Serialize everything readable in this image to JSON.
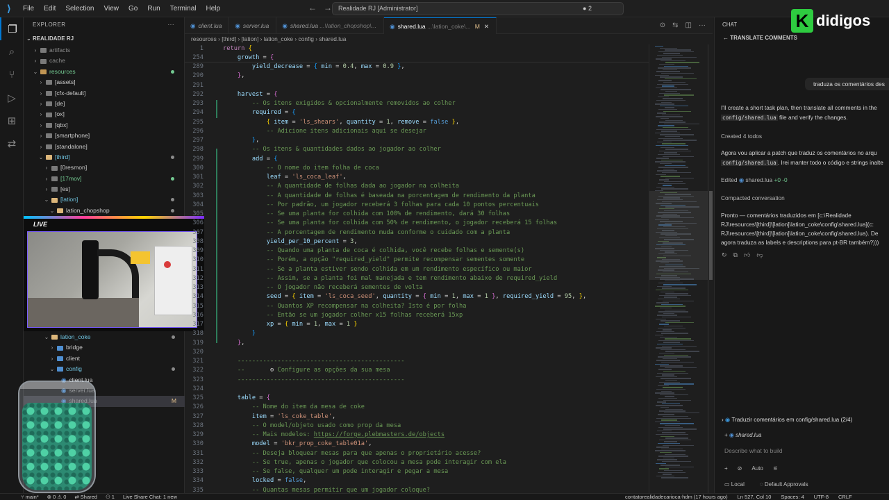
{
  "title_bar": {
    "menu": [
      "File",
      "Edit",
      "Selection",
      "View",
      "Go",
      "Run",
      "Terminal",
      "Help"
    ],
    "search_text": "Realidade RJ [Administrator]",
    "badge": "2"
  },
  "explorer": {
    "header": "EXPLORER",
    "root": "REALIDADE RJ",
    "items": [
      {
        "label": "artifacts",
        "indent": 1,
        "chev": "›"
      },
      {
        "label": "cache",
        "indent": 1,
        "chev": "›"
      },
      {
        "label": "resources",
        "indent": 1,
        "chev": "⌄"
      },
      {
        "label": "[assets]",
        "indent": 2,
        "chev": "›"
      },
      {
        "label": "[cfx-default]",
        "indent": 2,
        "chev": "›"
      },
      {
        "label": "[de]",
        "indent": 2,
        "chev": "›"
      },
      {
        "label": "[ox]",
        "indent": 2,
        "chev": "›"
      },
      {
        "label": "[qbx]",
        "indent": 2,
        "chev": "›"
      },
      {
        "label": "[smartphone]",
        "indent": 2,
        "chev": "›"
      },
      {
        "label": "[standalone]",
        "indent": 2,
        "chev": "›"
      },
      {
        "label": "[third]",
        "indent": 2,
        "chev": "⌄"
      },
      {
        "label": "[0resmon]",
        "indent": 3,
        "chev": "›"
      },
      {
        "label": "[17mov]",
        "indent": 3,
        "chev": "›"
      },
      {
        "label": "[es]",
        "indent": 3,
        "chev": "›"
      },
      {
        "label": "[lation]",
        "indent": 3,
        "chev": "⌄"
      },
      {
        "label": "lation_chopshop",
        "indent": 4,
        "chev": "⌄"
      }
    ],
    "items_lower": [
      {
        "label": "lation_coke",
        "indent": 3,
        "chev": "⌄"
      },
      {
        "label": "bridge",
        "indent": 4,
        "chev": "›"
      },
      {
        "label": "client",
        "indent": 4,
        "chev": "›"
      },
      {
        "label": "config",
        "indent": 4,
        "chev": "⌄"
      },
      {
        "label": "client.lua",
        "indent": 5,
        "chev": ""
      },
      {
        "label": "server.lua",
        "indent": 5,
        "chev": ""
      },
      {
        "label": "shared.lua",
        "indent": 5,
        "chev": ""
      }
    ],
    "modified_marker": "M",
    "live_label": "LIVE"
  },
  "tabs": [
    {
      "label": "client.lua",
      "sub": "",
      "active": false
    },
    {
      "label": "server.lua",
      "sub": "",
      "active": false
    },
    {
      "label": "shared.lua",
      "sub": "...\\lation_chopshop\\...",
      "active": false
    },
    {
      "label": "shared.lua",
      "sub": "...\\lation_coke\\...",
      "active": true,
      "mod": "M"
    }
  ],
  "breadcrumb": "resources › [third] › [lation] › lation_coke › config › shared.lua",
  "code": {
    "sticky": [
      {
        "n": "1",
        "t": "<span class='k'>return</span> <span class='br1'>{</span>"
      },
      {
        "n": "254",
        "t": "    <span class='v'>growth</span> = <span class='br2'>{</span>"
      }
    ],
    "lines": [
      {
        "n": "289",
        "t": "        <span class='v'>yield_decrease</span> = <span class='br3'>{</span> <span class='v'>min</span> = <span class='n'>0.4</span>, <span class='v'>max</span> = <span class='n'>0.9</span> <span class='br3'>}</span>,"
      },
      {
        "n": "290",
        "t": "    <span class='br2'>}</span>,"
      },
      {
        "n": "291",
        "t": ""
      },
      {
        "n": "292",
        "t": "    <span class='v'>harvest</span> = <span class='br2'>{</span>"
      },
      {
        "n": "293",
        "t": "        <span class='cm'>-- Os itens exigidos &amp; opcionalmente removidos ao colher</span>"
      },
      {
        "n": "294",
        "t": "        <span class='v'>required</span> = <span class='br3'>{</span>"
      },
      {
        "n": "295",
        "t": "            <span class='br1'>{</span> <span class='v'>item</span> = <span class='s'>'ls_shears'</span>, <span class='v'>quantity</span> = <span class='n'>1</span>, <span class='v'>remove</span> = <span class='kw2'>false</span> <span class='br1'>}</span>,"
      },
      {
        "n": "296",
        "t": "            <span class='cm'>-- Adicione itens adicionais aqui se desejar</span>"
      },
      {
        "n": "297",
        "t": "        <span class='br3'>}</span>,"
      },
      {
        "n": "298",
        "t": "        <span class='cm'>-- Os itens &amp; quantidades dados ao jogador ao colher</span>"
      },
      {
        "n": "299",
        "t": "        <span class='v'>add</span> = <span class='br3'>{</span>"
      },
      {
        "n": "300",
        "t": "            <span class='cm'>-- O nome do item folha de coca</span>"
      },
      {
        "n": "301",
        "t": "            <span class='v'>leaf</span> = <span class='s'>'ls_coca_leaf'</span>,"
      },
      {
        "n": "302",
        "t": "            <span class='cm'>-- A quantidade de folhas dada ao jogador na colheita</span>"
      },
      {
        "n": "303",
        "t": "            <span class='cm'>-- A quantidade de folhas é baseada na porcentagem de rendimento da planta</span>"
      },
      {
        "n": "304",
        "t": "            <span class='cm'>-- Por padrão, um jogador receberá 3 folhas para cada 10 pontos percentuais</span>"
      },
      {
        "n": "305",
        "t": "            <span class='cm'>-- Se uma planta for colhida com 100% de rendimento, dará 30 folhas</span>"
      },
      {
        "n": "306",
        "t": "            <span class='cm'>-- Se uma planta for colhida com 50% de rendimento, o jogador receberá 15 folhas</span>"
      },
      {
        "n": "307",
        "t": "            <span class='cm'>-- A porcentagem de rendimento muda conforme o cuidado com a planta</span>"
      },
      {
        "n": "308",
        "t": "            <span class='v'>yield_per_10_percent</span> = <span class='n'>3</span>,"
      },
      {
        "n": "309",
        "t": "            <span class='cm'>-- Quando uma planta de coca é colhida, você recebe folhas e semente(s)</span>"
      },
      {
        "n": "310",
        "t": "            <span class='cm'>-- Porém, a opção \"required_yield\" permite recompensar sementes somente</span>"
      },
      {
        "n": "311",
        "t": "            <span class='cm'>-- Se a planta estiver sendo colhida em um rendimento específico ou maior</span>"
      },
      {
        "n": "312",
        "t": "            <span class='cm'>-- Assim, se a planta foi mal manejada e tem rendimento abaixo de required_yield</span>"
      },
      {
        "n": "313",
        "t": "            <span class='cm'>-- O jogador não receberá sementes de volta</span>"
      },
      {
        "n": "314",
        "t": "            <span class='v'>seed</span> = <span class='br1'>{</span> <span class='v'>item</span> = <span class='s'>'ls_coca_seed'</span>, <span class='v'>quantity</span> = <span class='br2'>{</span> <span class='v'>min</span> = <span class='n'>1</span>, <span class='v'>max</span> = <span class='n'>1</span> <span class='br2'>}</span>, <span class='v'>required_yield</span> = <span class='n'>95</span>, <span class='br1'>}</span>,"
      },
      {
        "n": "315",
        "t": "            <span class='cm'>-- Quantos XP recompensar na colheita? Isto é por folha</span>"
      },
      {
        "n": "316",
        "t": "            <span class='cm'>-- Então se um jogador colher x15 folhas receberá 15xp</span>"
      },
      {
        "n": "317",
        "t": "            <span class='v'>xp</span> = <span class='br1'>{</span> <span class='v'>min</span> = <span class='n'>1</span>, <span class='v'>max</span> = <span class='n'>1</span> <span class='br1'>}</span>"
      },
      {
        "n": "318",
        "t": "        <span class='br3'>}</span>"
      },
      {
        "n": "319",
        "t": "    <span class='br2'>}</span>,"
      },
      {
        "n": "320",
        "t": ""
      },
      {
        "n": "321",
        "t": "    <span class='cm'>----------------------------------------------</span>"
      },
      {
        "n": "322",
        "t": "    <span class='cm'>--</span>       <span style='color:#cccccc'>⚙</span> <span class='cm'>Configure as opções da sua mesa</span>"
      },
      {
        "n": "323",
        "t": "    <span class='cm'>----------------------------------------------</span>"
      },
      {
        "n": "324",
        "t": ""
      },
      {
        "n": "325",
        "t": "    <span class='v'>table</span> = <span class='br2'>{</span>"
      },
      {
        "n": "326",
        "t": "        <span class='cm'>-- Nome do item da mesa de coke</span>"
      },
      {
        "n": "327",
        "t": "        <span class='v'>item</span> = <span class='s'>'ls_coke_table'</span>,"
      },
      {
        "n": "328",
        "t": "        <span class='cm'>-- O model/objeto usado como prop da mesa</span>"
      },
      {
        "n": "329",
        "t": "        <span class='cm'>-- Mais modelos: </span><span class='url'>https://forge.plebmasters.de/objects</span>"
      },
      {
        "n": "330",
        "t": "        <span class='v'>model</span> = <span class='s'>'bkr_prop_coke_table01a'</span>,"
      },
      {
        "n": "331",
        "t": "        <span class='cm'>-- Deseja bloquear mesas para que apenas o proprietário acesse?</span>"
      },
      {
        "n": "332",
        "t": "        <span class='cm'>-- Se true, apenas o jogador que colocou a mesa pode interagir com ela</span>"
      },
      {
        "n": "333",
        "t": "        <span class='cm'>-- Se false, qualquer um pode interagir e pegar a mesa</span>"
      },
      {
        "n": "334",
        "t": "        <span class='v'>locked</span> = <span class='kw2'>false</span>,"
      },
      {
        "n": "335",
        "t": "        <span class='cm'>-- Quantas mesas permitir que um jogador coloque?</span>"
      }
    ]
  },
  "chat": {
    "header": "CHAT",
    "subheader": "TRANSLATE COMMENTS",
    "brand": "didigos",
    "user_msg": "traduza os comentários des",
    "p1a": "I'll create a short task plan, then translate all comments in the",
    "p1b_code": "config/shared.lua",
    "p1b_rest": " file and verify the changes.",
    "todos": "Created 4 todos",
    "p2a": "Agora vou aplicar a patch que traduz os comentários no arqu",
    "p2b_code": "config/shared.lua",
    "p2b_rest": ". Irei manter todo o código e strings inalte",
    "edited": "Edited",
    "edited_file": "shared.lua",
    "edited_diff": "+0 -0",
    "compacted": "Compacted conversation",
    "p3": [
      "Pronto — comentários traduzidos em [c:\\Realidade",
      "RJ\\resources\\[third]\\[lation]\\lation_coke\\config\\shared.lua](c:",
      "RJ\\resources\\[third]\\[lation]\\lation_coke\\config\\shared.lua). De",
      "agora traduza as labels e descriptions para pt-BR também?)))"
    ],
    "task": "Traduzir comentários em config/shared.lua (2/4)",
    "attached_file": "shared.lua",
    "input_placeholder": "Describe what to build",
    "mode": "Auto",
    "footer_left": "Local",
    "footer_right": "Default Approvals"
  },
  "status": {
    "branch": "main*",
    "errors": "0",
    "warnings": "0",
    "shared": "Shared",
    "count": "1",
    "live_share": "Live Share Chat: 1 new",
    "blame": "contatorealidadecarioca-hdm (17 hours ago)",
    "position": "Ln 527, Col 10",
    "spaces": "Spaces: 4",
    "encoding": "UTF-8",
    "eol": "CRLF"
  }
}
